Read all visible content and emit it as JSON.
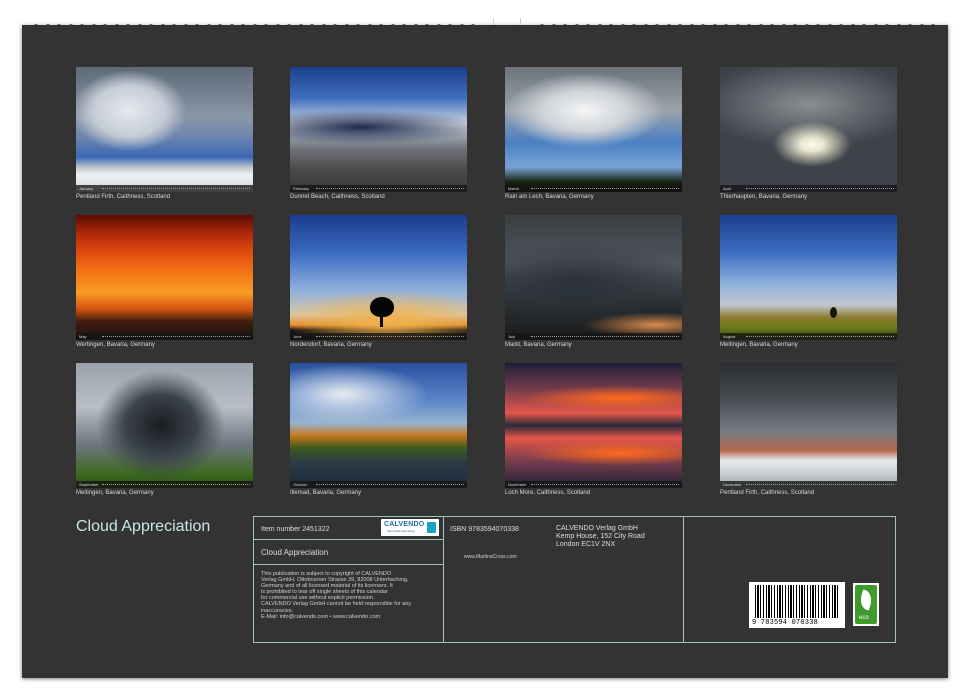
{
  "photos": [
    {
      "month": "January",
      "caption": "Pentland Firth, Caithness, Scotland"
    },
    {
      "month": "February",
      "caption": "Dunnet Beach, Caithness, Scotland"
    },
    {
      "month": "March",
      "caption": "Rain am Lech, Bavaria, Germany"
    },
    {
      "month": "April",
      "caption": "Thierhaupten, Bavaria, Germany"
    },
    {
      "month": "May",
      "caption": "Wertingen, Bavaria, Germany"
    },
    {
      "month": "June",
      "caption": "Nordendorf, Bavaria, Germany"
    },
    {
      "month": "July",
      "caption": "Markt, Bavaria, Germany"
    },
    {
      "month": "August",
      "caption": "Meitingen, Bavaria, Germany"
    },
    {
      "month": "September",
      "caption": "Meitingen, Bavaria, Germany"
    },
    {
      "month": "October",
      "caption": "Illemad, Bavaria, Germany"
    },
    {
      "month": "November",
      "caption": "Loch More, Caithness, Scotland"
    },
    {
      "month": "December",
      "caption": "Pentland Firth, Caithness, Scotland"
    }
  ],
  "calendar_title": "Cloud Appreciation",
  "info": {
    "item_number": "Item number 2451322",
    "logo_text": "CALVENDO",
    "logo_tagline": "Mein Kalenderverlag",
    "title": "Cloud Appreciation",
    "disclaimer_lines": [
      "This publication is subject to copyright of CALVENDO",
      "Verlag GmbH, Ottobrunner Strasse 39, 82008 Unterhaching,",
      "Germany and of all licensed material of its licensers. It",
      "is prohibited to tear off single sheets of this calendar",
      "for commercial use without explicit permission.",
      "CALVENDO Verlag GmbH cannot be held responsible for any",
      "inaccuracies.",
      "E-Mail: info@calvendo.com • www.calvendo.com"
    ],
    "isbn": "ISBN 9783594070338",
    "website": "www.MartinaCross.com",
    "publisher_lines": [
      "CALVENDO Verlag GmbH",
      "Kemp House, 152 City Road",
      "London EC1V 2NX"
    ],
    "barcode_digits": "9 783594 070338",
    "eco_label": "eco"
  },
  "colors": {
    "page_background": "#333333",
    "title_color": "#c9e6e6",
    "frame_color": "#9ec5c5"
  },
  "icons": {
    "logo": "calvendo-logo",
    "eco": "eco-leaf-icon",
    "barcode": "isbn-barcode"
  }
}
